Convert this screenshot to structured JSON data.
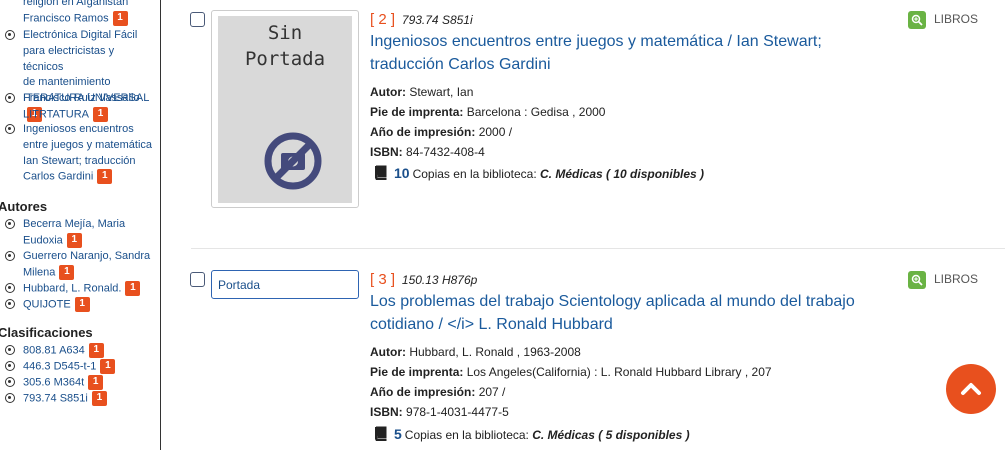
{
  "sidebar": {
    "title_items": [
      {
        "lines": [
          "religión en Afganistán",
          "Francisco Ramos"
        ],
        "count": "1",
        "radio": false
      },
      {
        "lines": [
          "Electrónica Digital Fácil",
          "para electricistas y técnicos",
          "de mantenimiento",
          "Francisco Ruiz Vassallo"
        ],
        "count": "1",
        "radio": true
      },
      {
        "lines": [
          "ITERATURA UNIVERSAL",
          "LITRTATURA"
        ],
        "count": "1",
        "radio": true
      },
      {
        "lines": [
          "Ingeniosos encuentros",
          "entre juegos y matemática",
          "Ian Stewart; traducción",
          "Carlos Gardini"
        ],
        "count": "1",
        "radio": true
      }
    ],
    "authors_heading": "Autores",
    "authors": [
      {
        "lines": [
          "Becerra Mejía, Maria",
          "Eudoxia"
        ],
        "count": "1"
      },
      {
        "lines": [
          "Guerrero Naranjo, Sandra",
          "Milena"
        ],
        "count": "1"
      },
      {
        "lines": [
          "Hubbard, L. Ronald."
        ],
        "count": "1"
      },
      {
        "lines": [
          "QUIJOTE"
        ],
        "count": "1"
      }
    ],
    "class_heading": "Clasificaciones",
    "classifications": [
      {
        "lines": [
          "808.81 A634"
        ],
        "count": "1"
      },
      {
        "lines": [
          "446.3 D545-t-1"
        ],
        "count": "1"
      },
      {
        "lines": [
          "305.6 M364t"
        ],
        "count": "1"
      },
      {
        "lines": [
          "793.74 S851i"
        ],
        "count": "1"
      }
    ]
  },
  "results": [
    {
      "number": "[ 2 ]",
      "call_number": "793.74 S851i",
      "title": "Ingeniosos encuentros entre juegos y matemática / Ian Stewart; traducción Carlos Gardini",
      "cover_text": "Sin Portada",
      "author_label": "Autor:",
      "author": "Stewart, Ian",
      "imprint_label": "Pie de imprenta:",
      "imprint": "Barcelona : Gedisa , 2000",
      "year_label": "Año de impresión:",
      "year": "2000 /",
      "isbn_label": "ISBN:",
      "isbn": "84-7432-408-4",
      "copies_count": "10",
      "copies_text": "Copias en la biblioteca:",
      "copies_detail": "C. Médicas ( 10 disponibles )",
      "type": "LIBROS"
    },
    {
      "number": "[ 3 ]",
      "call_number": "150.13 H876p",
      "title": "Los problemas del trabajo Scientology aplicada al mundo del trabajo cotidiano / </i> L. Ronald Hubbard",
      "cover_text": "Portada",
      "author_label": "Autor:",
      "author": "Hubbard, L. Ronald , 1963-2008",
      "imprint_label": "Pie de imprenta:",
      "imprint": "Los Angeles(California) : L. Ronald Hubbard Library , 207",
      "year_label": "Año de impresión:",
      "year": "207 /",
      "isbn_label": "ISBN:",
      "isbn": "978-1-4031-4477-5",
      "copies_count": "5",
      "copies_text": "Copias en la biblioteca:",
      "copies_detail": "C. Médicas ( 5 disponibles )",
      "type": "LIBROS"
    }
  ],
  "colors": {
    "accent": "#e8501e",
    "link": "#1a5a9c",
    "zoom": "#6ab344"
  },
  "icons": {
    "scroll_top": "chevron-up-icon",
    "book": "book-icon",
    "zoom": "zoom-in-icon",
    "no_cover": "no-image-icon"
  }
}
